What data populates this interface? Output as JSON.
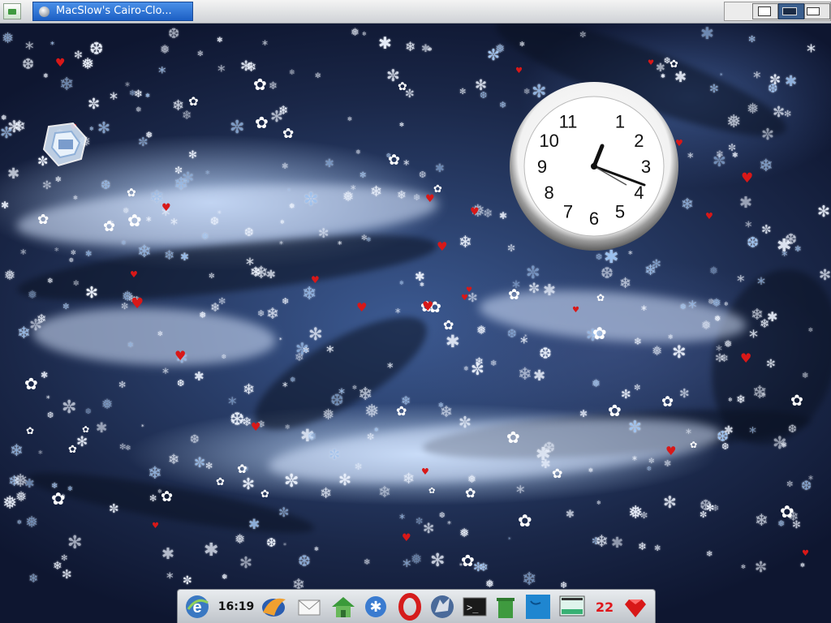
{
  "taskbar": {
    "launcher_icon": "window-icon",
    "active_window_title": "MacSlow's Cairo-Clo..."
  },
  "pager": {
    "workspaces": 2,
    "active_workspace": 2
  },
  "desktop": {
    "wallpaper": "blue water drops",
    "weather_effect": "snowflakes, daisies, red hearts"
  },
  "clock": {
    "numerals": [
      "1",
      "2",
      "3",
      "4",
      "5",
      "6",
      "7",
      "8",
      "9",
      "10",
      "11"
    ],
    "time_shown": "16:19"
  },
  "dock": {
    "items": [
      {
        "name": "browser-e-icon"
      },
      {
        "name": "clock-time",
        "text": "16:19"
      },
      {
        "name": "thunderbird-icon"
      },
      {
        "name": "mail-icon"
      },
      {
        "name": "home-folder-icon"
      },
      {
        "name": "network-icon"
      },
      {
        "name": "opera-icon"
      },
      {
        "name": "wolf-browser-icon"
      },
      {
        "name": "terminal-icon"
      },
      {
        "name": "trash-icon"
      },
      {
        "name": "blue-folder-icon"
      },
      {
        "name": "monitor-icon"
      },
      {
        "name": "calendar-date",
        "text": "22"
      },
      {
        "name": "ruby-icon"
      }
    ]
  },
  "colors": {
    "taskbar_active": "#2c70d8",
    "heart": "#d81818",
    "date_text": "#e0161b",
    "pager_active": "#3b5f8e"
  }
}
